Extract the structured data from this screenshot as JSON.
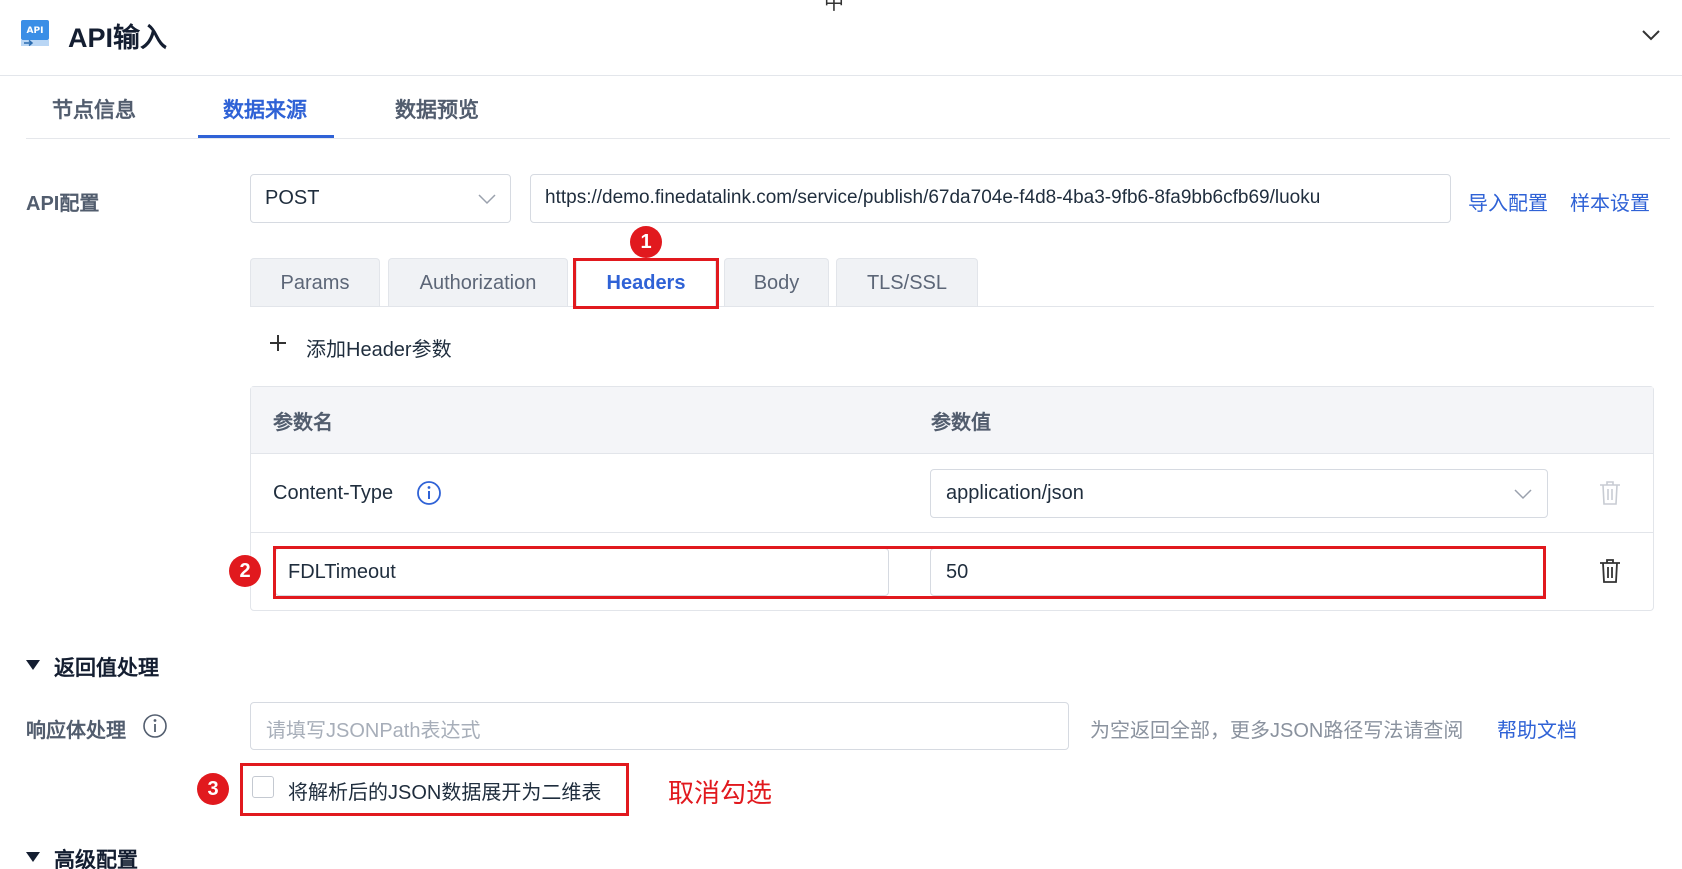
{
  "header": {
    "top_glyph": "中",
    "title": "API输入"
  },
  "tabs": [
    "节点信息",
    "数据来源",
    "数据预览"
  ],
  "active_tab": "数据来源",
  "api_config": {
    "label": "API配置",
    "method": "POST",
    "url": "https://demo.finedatalink.com/service/publish/67da704e-f4d8-4ba3-9fb6-8fa9bb6cfb69/luoku",
    "import_link": "导入配置",
    "sample_link": "样本设置"
  },
  "sub_tabs": [
    "Params",
    "Authorization",
    "Headers",
    "Body",
    "TLS/SSL"
  ],
  "active_sub_tab": "Headers",
  "add_header_label": "添加Header参数",
  "table": {
    "col_name": "参数名",
    "col_value": "参数值",
    "rows": [
      {
        "name": "Content-Type",
        "value": "application/json"
      },
      {
        "name": "FDLTimeout",
        "value": "50"
      }
    ]
  },
  "annotations": {
    "badge1": "1",
    "badge2": "2",
    "badge3": "3",
    "note": "取消勾选"
  },
  "response_section": {
    "title": "返回值处理",
    "body_label": "响应体处理",
    "jsonpath_placeholder": "请填写JSONPath表达式",
    "hint": "为空返回全部，更多JSON路径写法请查阅",
    "help_link": "帮助文档",
    "checkbox_label": "将解析后的JSON数据展开为二维表",
    "checkbox_checked": false
  },
  "advanced_section": {
    "title": "高级配置"
  },
  "colors": {
    "accent": "#2f62d6",
    "annotation_red": "#e1191e"
  }
}
